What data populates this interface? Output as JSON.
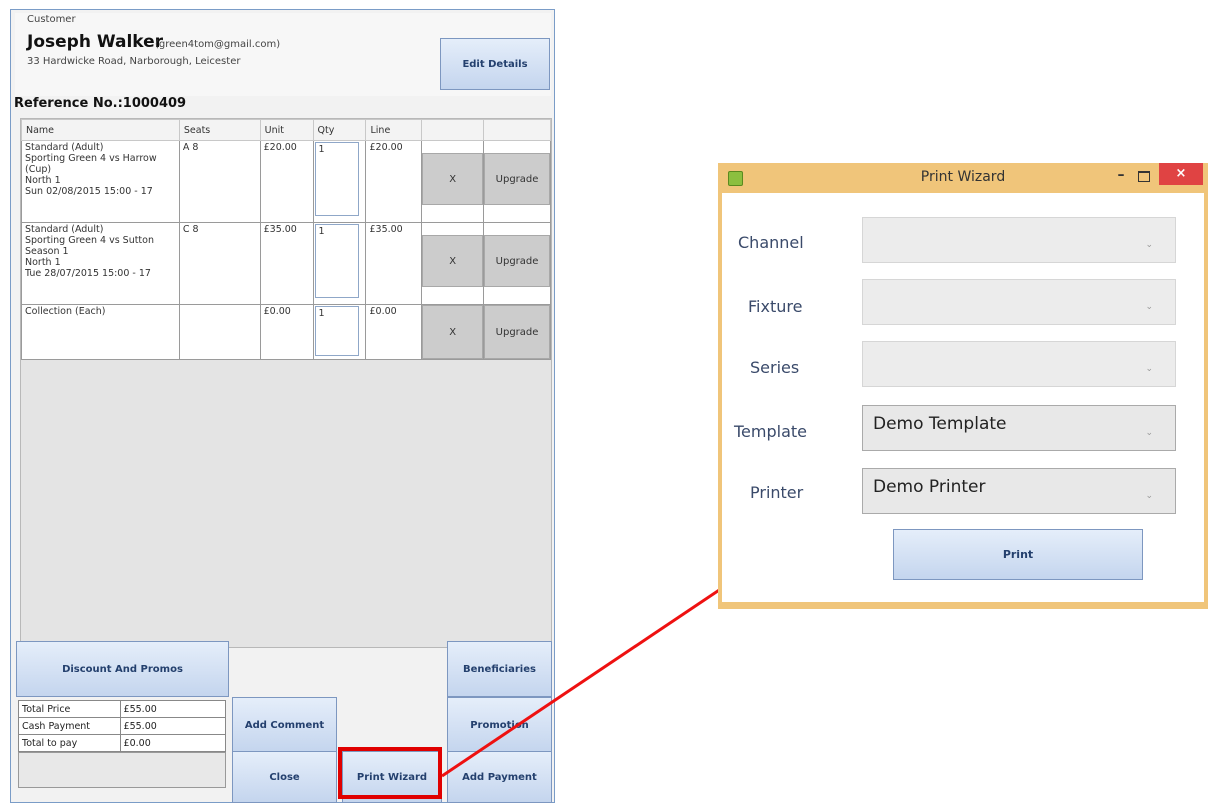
{
  "customer": {
    "section_label": "Customer",
    "name": "Joseph Walker",
    "email": "(green4tom@gmail.com)",
    "address": "33 Hardwicke Road, Narborough, Leicester",
    "edit_button": "Edit Details"
  },
  "reference": "Reference No.:1000409",
  "lines_table": {
    "headers": [
      "Name",
      "Seats",
      "Unit",
      "Qty",
      "Line"
    ],
    "rows": [
      {
        "name_lines": [
          "Standard (Adult)",
          "Sporting Green 4 vs Harrow",
          "(Cup)",
          "North 1",
          "Sun 02/08/2015 15:00 - 17"
        ],
        "seats": "A 8",
        "unit": "£20.00",
        "qty": "1",
        "line": "£20.00",
        "remove": "X",
        "upgrade": "Upgrade"
      },
      {
        "name_lines": [
          "Standard (Adult)",
          "Sporting Green 4 vs Sutton",
          "Season 1",
          "North 1",
          "Tue 28/07/2015 15:00 - 17"
        ],
        "seats": "C 8",
        "unit": "£35.00",
        "qty": "1",
        "line": "£35.00",
        "remove": "X",
        "upgrade": "Upgrade"
      },
      {
        "name_lines": [
          "Collection (Each)"
        ],
        "seats": "",
        "unit": "£0.00",
        "qty": "1",
        "line": "£0.00",
        "remove": "X",
        "upgrade": "Upgrade"
      }
    ]
  },
  "buttons": {
    "discount": "Discount And Promos",
    "beneficiaries": "Beneficiaries",
    "add_comment": "Add Comment",
    "promotion": "Promotion",
    "close": "Close",
    "print_wizard": "Print Wizard",
    "add_payment": "Add Payment"
  },
  "totals": [
    {
      "label": "Total Price",
      "value": "£55.00"
    },
    {
      "label": "Cash Payment",
      "value": "£55.00"
    },
    {
      "label": "Total to pay",
      "value": "£0.00"
    }
  ],
  "wizard": {
    "title": "Print Wizard",
    "fields": [
      {
        "label": "Channel",
        "value": ""
      },
      {
        "label": "Fixture",
        "value": ""
      },
      {
        "label": "Series",
        "value": ""
      },
      {
        "label": "Template",
        "value": "Demo Template"
      },
      {
        "label": "Printer",
        "value": "Demo Printer"
      }
    ],
    "print_button": "Print"
  },
  "colors": {
    "highlight": "#e00000",
    "arrow": "#ee1111",
    "window_border": "#f0c57a",
    "close_button": "#e04343"
  },
  "icons": [
    "app-icon",
    "minimize-icon",
    "maximize-icon",
    "close-icon",
    "dropdown-arrow-icon"
  ]
}
